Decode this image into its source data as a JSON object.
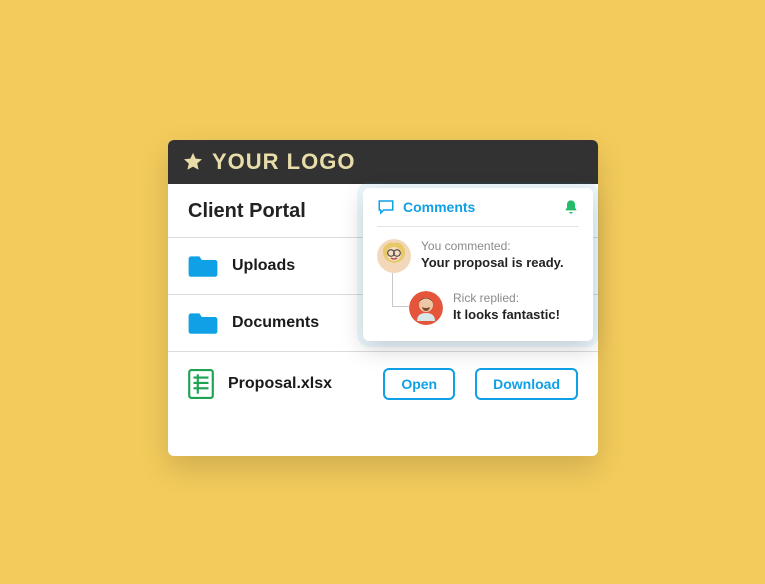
{
  "header": {
    "logo_text": "YOUR LOGO"
  },
  "page_title": "Client Portal",
  "rows": {
    "uploads": {
      "label": "Uploads"
    },
    "documents": {
      "label": "Documents"
    },
    "file": {
      "label": "Proposal.xlsx",
      "open_label": "Open",
      "download_label": "Download"
    }
  },
  "popover": {
    "title": "Comments",
    "comments": [
      {
        "meta": "You commented:",
        "text": "Your proposal is ready."
      },
      {
        "meta": "Rick replied:",
        "text": "It looks fantastic!"
      }
    ]
  },
  "colors": {
    "accent": "#0fa0e6",
    "bell": "#26bb6a"
  }
}
